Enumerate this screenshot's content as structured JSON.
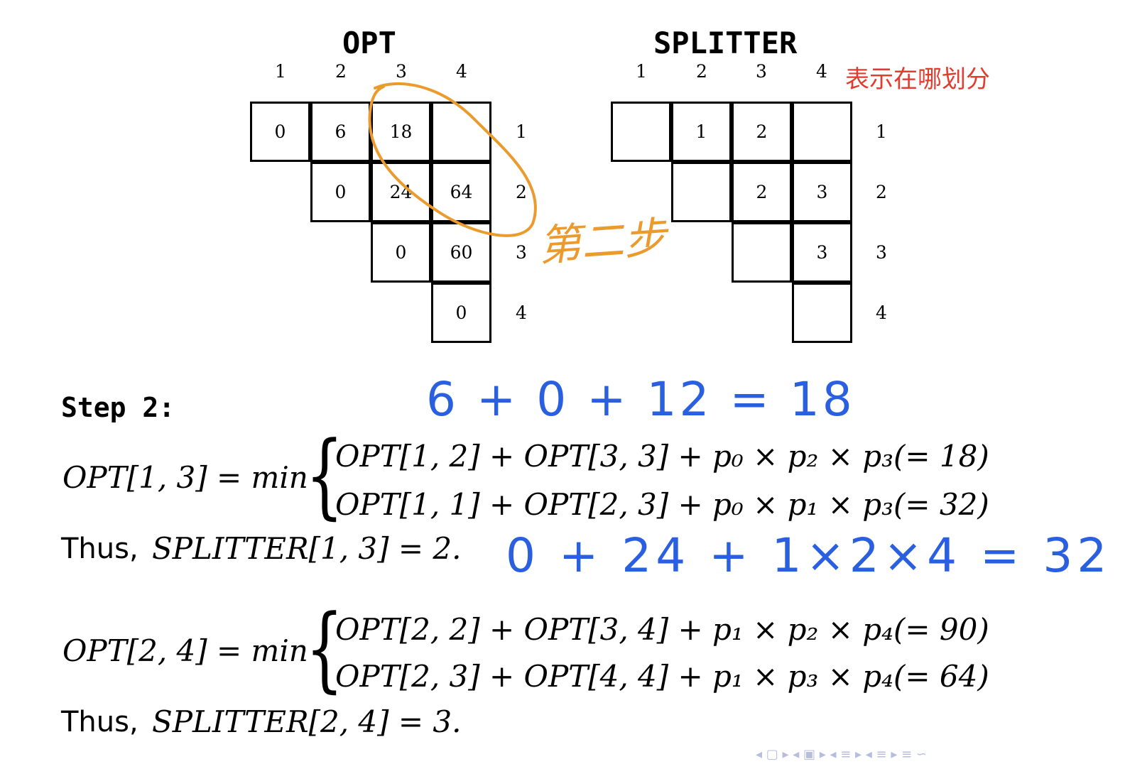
{
  "opt": {
    "title": "OPT",
    "col_numbers": [
      "1",
      "2",
      "3",
      "4"
    ],
    "row_numbers": [
      "1",
      "2",
      "3",
      "4"
    ],
    "rows": [
      [
        "0",
        "6",
        "18",
        ""
      ],
      [
        "0",
        "24",
        "64"
      ],
      [
        "0",
        "60"
      ],
      [
        "0"
      ]
    ]
  },
  "splitter": {
    "title": "SPLITTER",
    "col_numbers": [
      "1",
      "2",
      "3",
      "4"
    ],
    "row_numbers": [
      "1",
      "2",
      "3",
      "4"
    ],
    "rows": [
      [
        "",
        "1",
        "2",
        ""
      ],
      [
        "",
        "2",
        "3"
      ],
      [
        "",
        "3"
      ],
      [
        ""
      ]
    ]
  },
  "annotations": {
    "splitter_note": "表示在哪划分",
    "second_step_note": "第二步",
    "calc_line_1": "6 + 0 + 12 = 18",
    "calc_line_2": "0 + 24 + 1×2×4 = 32",
    "ink_orange": "#eb9a2e",
    "ink_blue": "#2a5fe0",
    "ink_red": "#e03c2f"
  },
  "step": {
    "title": "Step 2:",
    "eq1": {
      "lhs": "OPT[1, 3] = min",
      "case1": "OPT[1, 2] + OPT[3, 3] + p₀ × p₂ × p₃(= 18)",
      "case2": "OPT[1, 1] + OPT[2, 3] + p₀ × p₁ × p₃(= 32)",
      "thus_word": "Thus,",
      "thus_expr": "SPLITTER[1, 3] = 2."
    },
    "eq2": {
      "lhs": "OPT[2, 4] = min",
      "case1": "OPT[2, 2] + OPT[3, 4] + p₁ × p₂ × p₄(= 90)",
      "case2": "OPT[2, 3] + OPT[4, 4] + p₁ × p₃ × p₄(= 64)",
      "thus_word": "Thus,",
      "thus_expr": "SPLITTER[2, 4] = 3."
    }
  },
  "nav_symbols": "◂ ▢ ▸ ◂ ▣ ▸ ◂ ≡ ▸ ◂ ≡ ▸ ≡ ∽"
}
